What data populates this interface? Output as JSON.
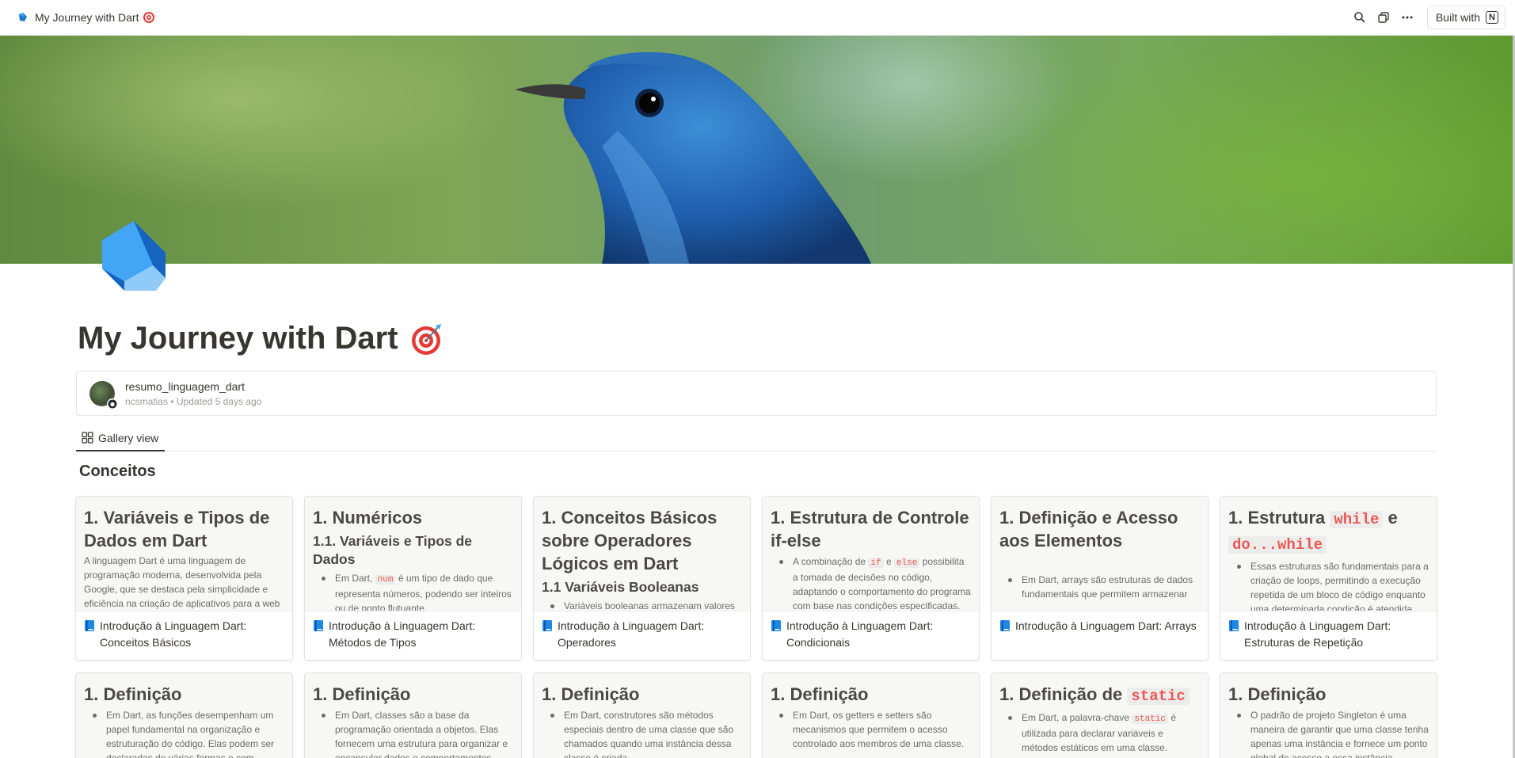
{
  "topbar": {
    "title": "My Journey with Dart",
    "built_label": "Built with",
    "notion_glyph": "N",
    "icons": [
      "search-icon",
      "duplicate-icon",
      "more-icon"
    ]
  },
  "page": {
    "title": "My Journey with Dart",
    "source_name": "resumo_linguagem_dart",
    "source_meta": "ncsmatias • Updated 5 days ago"
  },
  "view": {
    "tab_label": "Gallery view",
    "section_title": "Conceitos"
  },
  "cards_row1": [
    {
      "h1": "1. Variáveis e Tipos de Dados em Dart",
      "p": "A linguagem Dart é uma linguagem de programação moderna, desenvolvida pela Google, que se destaca pela simplicidade e eficiência na criação de aplicativos para a web",
      "title": "Introdução à Linguagem Dart: Conceitos Básicos"
    },
    {
      "h1": "1. Numéricos",
      "h2": "1.1. Variáveis e Tipos de Dados",
      "li_a": "Em Dart, ",
      "li_code": "num",
      "li_b": " é um tipo de dado que representa números, podendo ser inteiros ou de ponto flutuante.",
      "title": "Introdução à Linguagem Dart: Métodos de Tipos"
    },
    {
      "h1": "1. Conceitos Básicos sobre Operadores Lógicos em Dart",
      "h2": "1.1 Variáveis Booleanas",
      "li": "Variáveis booleanas armazenam valores",
      "title": "Introdução à Linguagem Dart: Operadores"
    },
    {
      "h1": "1. Estrutura de Controle if-else",
      "li_a": "A combinação de ",
      "code1": "if",
      "li_b": " e ",
      "code2": "else",
      "li_c": " possibilita a tomada de decisões no código, adaptando o comportamento do programa com base nas condições especificadas.",
      "title": "Introdução à Linguagem Dart: Condicionais"
    },
    {
      "h1": "1. Definição e Acesso aos Elementos",
      "li": "Em Dart, arrays são estruturas de dados fundamentais que permitem armazenar",
      "title": "Introdução à Linguagem Dart: Arrays"
    },
    {
      "h1_a": "1. Estrutura ",
      "code1": "while",
      "h1_b": " e ",
      "code2": "do...while",
      "li": "Essas estruturas são fundamentais para a criação de loops, permitindo a execução repetida de um bloco de código enquanto uma determinada condição é atendida.",
      "title": "Introdução à Linguagem Dart: Estruturas de Repetição"
    }
  ],
  "cards_row2": [
    {
      "h1": "1. Definição",
      "li": "Em Dart, as funções desempenham um papel fundamental na organização e estruturação do código. Elas podem ser declaradas de várias formas e com"
    },
    {
      "h1": "1. Definição",
      "li": "Em Dart, classes são a base da programação orientada a objetos. Elas fornecem uma estrutura para organizar e encapsular dados e comportamentos"
    },
    {
      "h1": "1. Definição",
      "li": "Em Dart, construtores são métodos especiais dentro de uma classe que são chamados quando uma instância dessa classe é criada."
    },
    {
      "h1": "1. Definição",
      "li": "Em Dart, os getters e setters são mecanismos que permitem o acesso controlado aos membros de uma classe."
    },
    {
      "h1_a": "1. Definição de ",
      "code1": "static",
      "li_a": "Em Dart, a palavra-chave ",
      "li_code": "static",
      "li_b": " é utilizada para declarar variáveis e métodos estáticos em uma classe."
    },
    {
      "h1": "1. Definição",
      "li": "O padrão de projeto Singleton é uma maneira de garantir que uma classe tenha apenas uma instância e fornece um ponto global de acesso a essa instância."
    }
  ]
}
